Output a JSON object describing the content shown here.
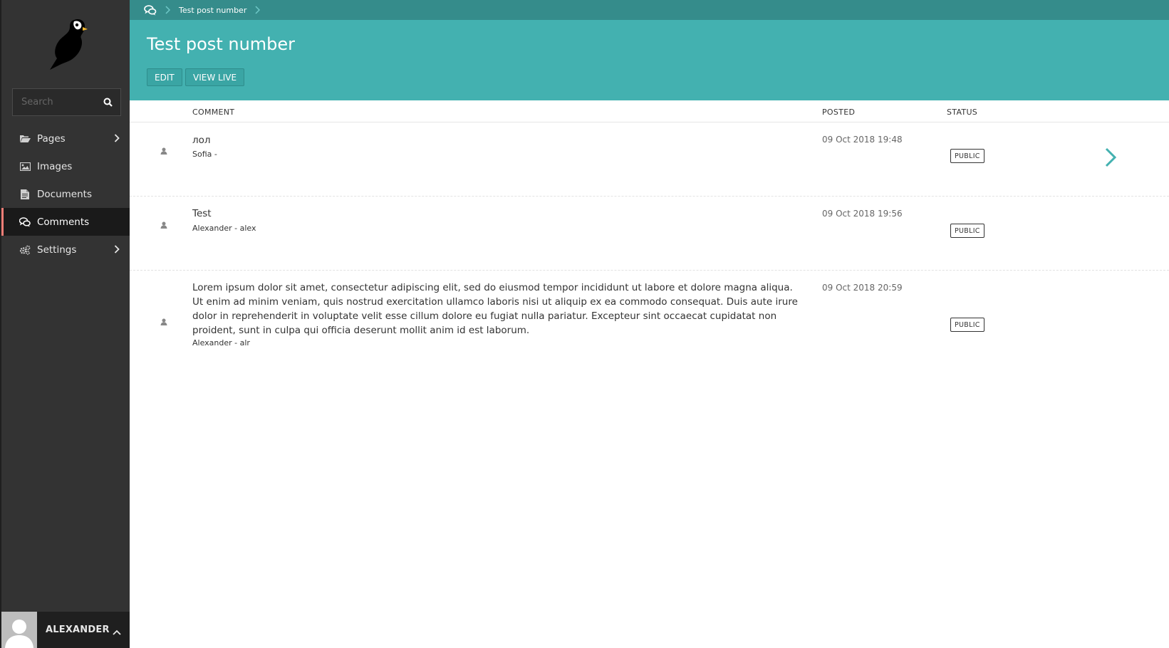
{
  "breadcrumb": {
    "current": "Test post number"
  },
  "header": {
    "title": "Test post number",
    "edit_label": "EDIT",
    "view_live_label": "VIEW LIVE"
  },
  "search": {
    "placeholder": "Search"
  },
  "sidebar": {
    "items": [
      {
        "label": "Pages",
        "icon": "folder-open-icon",
        "has_submenu": true
      },
      {
        "label": "Images",
        "icon": "image-icon",
        "has_submenu": false
      },
      {
        "label": "Documents",
        "icon": "document-icon",
        "has_submenu": false
      },
      {
        "label": "Comments",
        "icon": "comments-icon",
        "has_submenu": false,
        "active": true
      },
      {
        "label": "Settings",
        "icon": "cogs-icon",
        "has_submenu": true
      }
    ]
  },
  "user": {
    "name": "ALEXANDER"
  },
  "table": {
    "columns": {
      "comment": "COMMENT",
      "posted": "POSTED",
      "status": "STATUS"
    },
    "rows": [
      {
        "text": "лол",
        "author": "Sofia -",
        "posted": "09 Oct 2018 19:48",
        "status": "PUBLIC"
      },
      {
        "text": "Test",
        "author": "Alexander - alex",
        "posted": "09 Oct 2018 19:56",
        "status": "PUBLIC"
      },
      {
        "text": "Lorem ipsum dolor sit amet, consectetur adipiscing elit, sed do eiusmod tempor incididunt ut labore et dolore magna aliqua. Ut enim ad minim veniam, quis nostrud exercitation ullamco laboris nisi ut aliquip ex ea commodo consequat. Duis aute irure dolor in reprehenderit in voluptate velit esse cillum dolore eu fugiat nulla pariatur. Excepteur sint occaecat cupidatat non proident, sunt in culpa qui officia deserunt mollit anim id est laborum.",
        "author": "Alexander - alr",
        "posted": "09 Oct 2018 20:59",
        "status": "PUBLIC"
      }
    ]
  },
  "colors": {
    "accent": "#43b1b0",
    "accent_dark": "#358c8b",
    "sidebar_bg": "#333333",
    "active_marker": "#f37e77"
  }
}
